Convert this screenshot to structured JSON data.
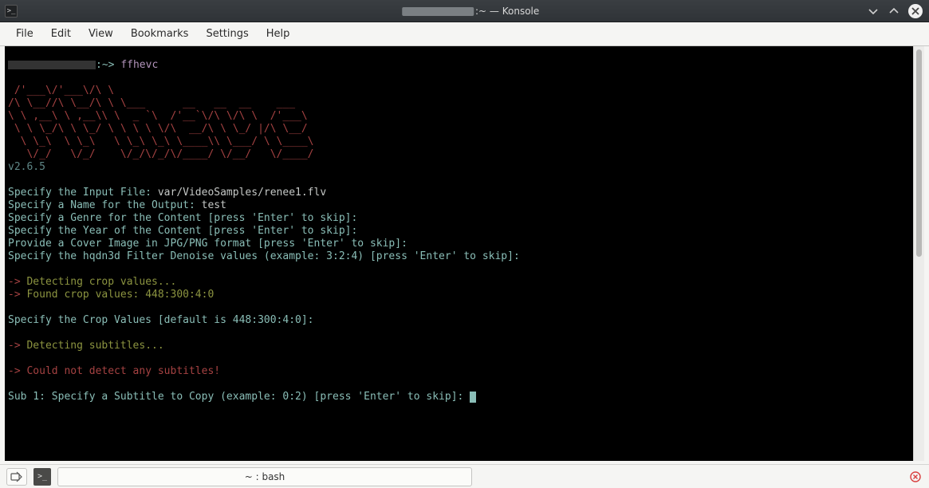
{
  "window": {
    "title_suffix": ":~ — Konsole"
  },
  "menubar": {
    "items": [
      "File",
      "Edit",
      "View",
      "Bookmarks",
      "Settings",
      "Help"
    ]
  },
  "terminal": {
    "prompt_path": ":~>",
    "command": "ffhevc",
    "ascii_logo": [
      " /'___\\/'___\\/\\ \\",
      "/\\ \\__//\\ \\__/\\ \\ \\___      __   __  __    ___",
      "\\ \\ ,__\\ \\ ,__\\\\ \\  _ `\\  /'__`\\/\\ \\/\\ \\  /'___\\",
      " \\ \\ \\_/\\ \\ \\_/ \\ \\ \\ \\ \\/\\  __/\\ \\ \\_/ |/\\ \\__/",
      "  \\ \\_\\  \\ \\_\\   \\ \\_\\ \\_\\ \\____\\\\ \\___/ \\ \\____\\",
      "   \\/_/   \\/_/    \\/_/\\/_/\\/____/ \\/__/   \\/____/"
    ],
    "version": "v2.6.5",
    "prompts": {
      "input_file_q": "Specify the Input File: ",
      "input_file_a": "var/VideoSamples/renee1.flv",
      "output_name_q": "Specify a Name for the Output: ",
      "output_name_a": "test",
      "genre_q": "Specify a Genre for the Content [press 'Enter' to skip]:",
      "year_q": "Specify the Year of the Content [press 'Enter' to skip]:",
      "cover_q": "Provide a Cover Image in JPG/PNG format [press 'Enter' to skip]:",
      "hqdn3d_q": "Specify the hqdn3d Filter Denoise values (example: 3:2:4) [press 'Enter' to skip]:",
      "crop_q": "Specify the Crop Values [default is 448:300:4:0]:",
      "sub1_q": "Sub 1: Specify a Subtitle to Copy (example: 0:2) [press 'Enter' to skip]: "
    },
    "status": {
      "arrow": "->",
      "detect_crop": " Detecting crop values...",
      "found_crop": " Found crop values: 448:300:4:0",
      "detect_subs": " Detecting subtitles...",
      "no_subs": " Could not detect any subtitles!"
    }
  },
  "bottombar": {
    "tab_label": "~ : bash"
  }
}
